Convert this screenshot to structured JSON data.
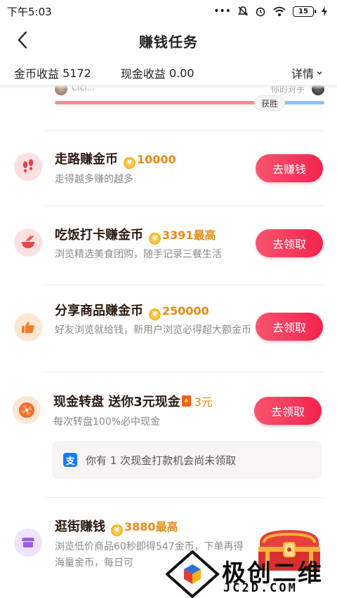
{
  "status_bar": {
    "time": "下午5:03",
    "battery": "15"
  },
  "header": {
    "title": "赚钱任务"
  },
  "earnings": {
    "coin_label": "金币收益",
    "coin_value": "5172",
    "cash_label": "现金收益",
    "cash_value": "0.00",
    "detail_label": "详情"
  },
  "pk": {
    "left_name": "Cici...",
    "right_name": "你的对手",
    "win_label": "获胜"
  },
  "tasks": [
    {
      "title": "走路赚金币",
      "reward": "10000",
      "desc": "走得越多赚的越多",
      "button": "去赚钱",
      "icon": "footprints-icon"
    },
    {
      "title": "吃饭打卡赚金币",
      "reward": "3391最高",
      "desc": "浏览精选美食团购，随手记录三餐生活",
      "button": "去领取",
      "icon": "bowl-icon"
    },
    {
      "title": "分享商品赚金币",
      "reward": "250000",
      "desc": "好友浏览就给钱，新用户浏览必得超大额金币",
      "button": "去领取",
      "icon": "thumbs-up-icon"
    },
    {
      "title": "现金转盘 送你3元现金",
      "reward": "3元",
      "desc": "每次转盘100%必中现金",
      "button": "去领取",
      "icon": "wheel-icon"
    },
    {
      "title": "逛街赚钱",
      "reward": "3880最高",
      "desc": "浏览低价商品60秒即得547金币，下单再得海量金币，每日可",
      "icon": "shop-icon"
    }
  ],
  "notice": {
    "text": "你有 1 次现金打款机会尚未领取"
  },
  "watermark": {
    "name": "极创二维",
    "url": "JC2D.COM"
  },
  "colors": {
    "accent": "#f2234d",
    "coin": "#e58b12"
  }
}
